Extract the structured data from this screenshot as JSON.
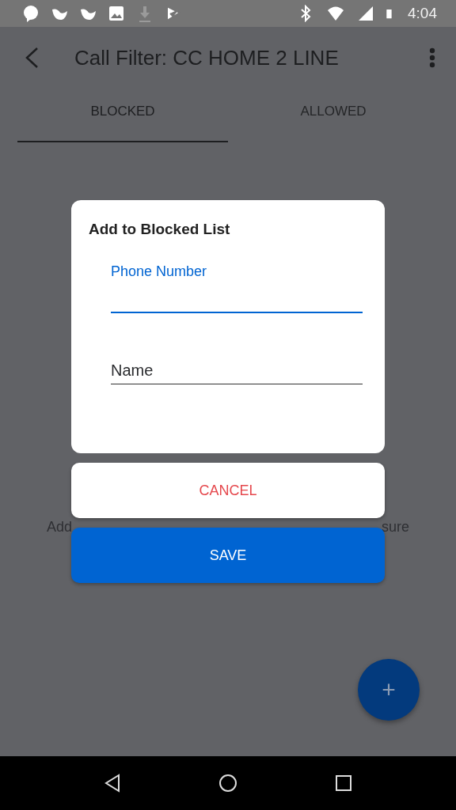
{
  "status_bar": {
    "time": "4:04"
  },
  "toolbar": {
    "title": "Call Filter: CC HOME 2 LINE"
  },
  "tabs": [
    {
      "label": "BLOCKED",
      "selected": true
    },
    {
      "label": "ALLOWED",
      "selected": false
    }
  ],
  "empty_message_visible_parts": [
    "Add",
    "sure"
  ],
  "dialog": {
    "title": "Add to Blocked List",
    "fields": [
      {
        "label": "Phone Number",
        "focused": true
      },
      {
        "placeholder": "Name",
        "focused": false
      }
    ]
  },
  "actions": [
    {
      "label": "CANCEL",
      "kind": "cancel"
    },
    {
      "label": "SAVE",
      "kind": "save"
    }
  ],
  "fab": {
    "label": "+"
  }
}
